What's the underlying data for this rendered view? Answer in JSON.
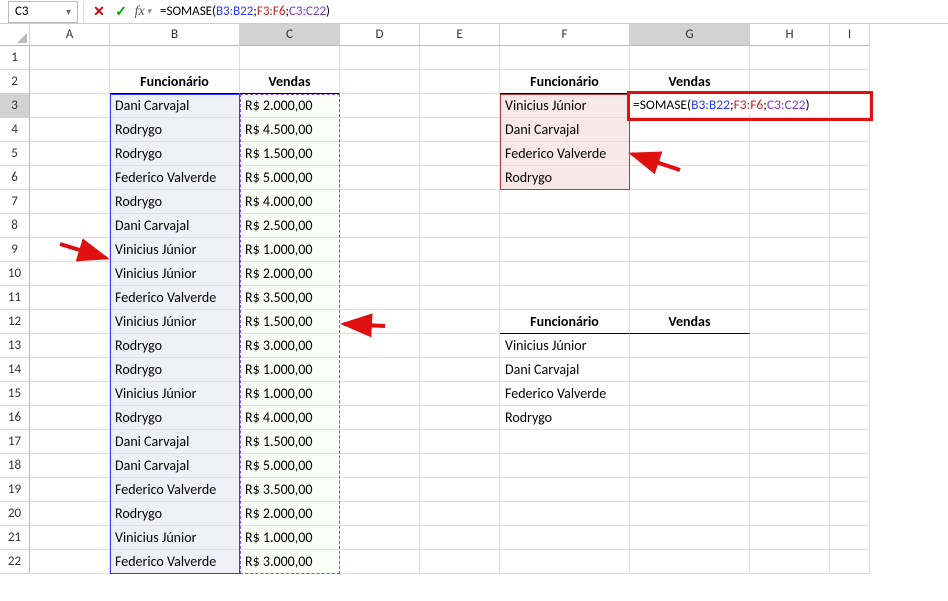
{
  "namebox": "C3",
  "formula": {
    "prefix": "=SOMASE(",
    "range1": "B3:B22",
    "sep1": ";",
    "range2": "F3:F6",
    "sep2": ";",
    "range3": "C3:C22",
    "suffix": ")"
  },
  "columns": [
    "A",
    "B",
    "C",
    "D",
    "E",
    "F",
    "G",
    "H",
    "I"
  ],
  "rows": [
    "1",
    "2",
    "3",
    "4",
    "5",
    "6",
    "7",
    "8",
    "9",
    "10",
    "11",
    "12",
    "13",
    "14",
    "15",
    "16",
    "17",
    "18",
    "19",
    "20",
    "21",
    "22"
  ],
  "headers": {
    "func": "Funcionário",
    "vendas": "Vendas"
  },
  "table1": [
    {
      "name": "Dani   Carvajal",
      "val": "R$ 2.000,00"
    },
    {
      "name": "Rodrygo",
      "val": "R$ 4.500,00"
    },
    {
      "name": "Rodrygo",
      "val": "R$ 1.500,00"
    },
    {
      "name": "Federico   Valverde",
      "val": "R$ 5.000,00"
    },
    {
      "name": "Rodrygo",
      "val": "R$ 4.000,00"
    },
    {
      "name": "Dani   Carvajal",
      "val": "R$ 2.500,00"
    },
    {
      "name": "Vinicius Júnior",
      "val": "R$ 1.000,00"
    },
    {
      "name": "Vinicius Júnior",
      "val": "R$ 2.000,00"
    },
    {
      "name": "Federico Valverde",
      "val": "R$ 3.500,00"
    },
    {
      "name": "Vinicius Júnior",
      "val": "R$ 1.500,00"
    },
    {
      "name": "Rodrygo",
      "val": "R$ 3.000,00"
    },
    {
      "name": "Rodrygo",
      "val": "R$ 1.000,00"
    },
    {
      "name": "Vinicius Júnior",
      "val": "R$ 1.000,00"
    },
    {
      "name": "Rodrygo",
      "val": "R$ 4.000,00"
    },
    {
      "name": "Dani   Carvajal",
      "val": "R$ 1.500,00"
    },
    {
      "name": "Dani Carvajal",
      "val": "R$ 5.000,00"
    },
    {
      "name": "Federico  Valverde",
      "val": "R$ 3.500,00"
    },
    {
      "name": "Rodrygo",
      "val": "R$ 2.000,00"
    },
    {
      "name": "Vinicius Júnior",
      "val": "R$ 1.000,00"
    },
    {
      "name": "Federico Valverde",
      "val": "R$ 3.000,00"
    }
  ],
  "table2": [
    "Vinicius Júnior",
    "Dani Carvajal",
    "Federico Valverde",
    "Rodrygo"
  ],
  "table3": [
    "Vinicius Júnior",
    "Dani Carvajal",
    "Federico Valverde",
    "Rodrygo"
  ]
}
